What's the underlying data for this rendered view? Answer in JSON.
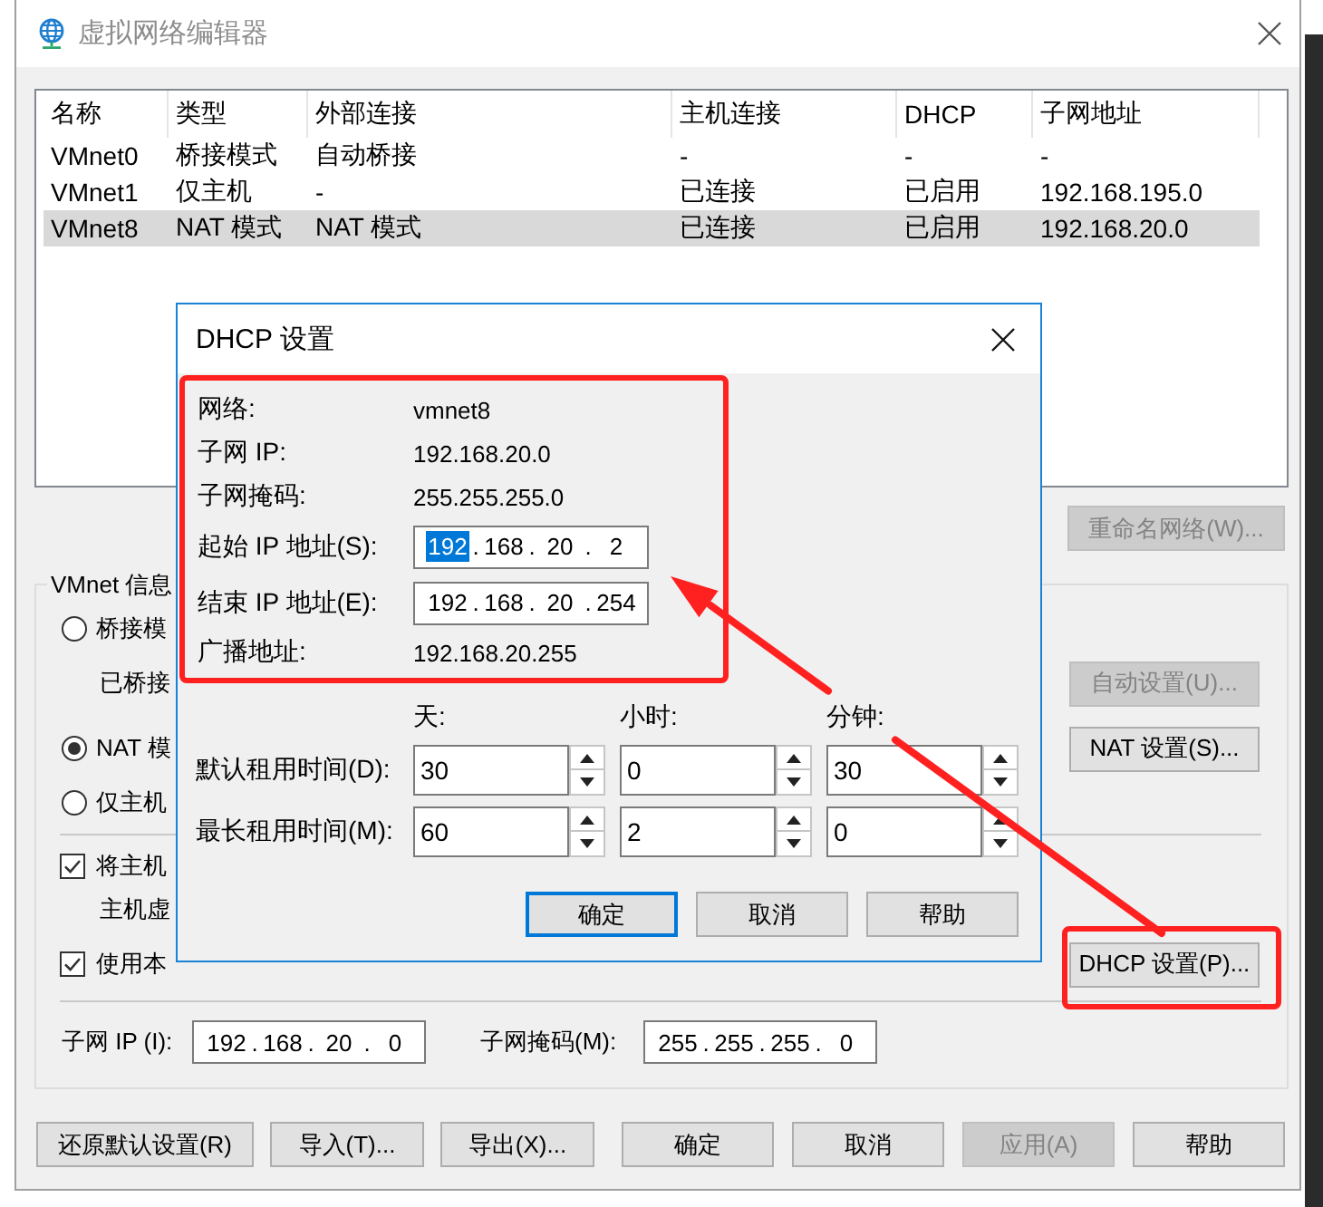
{
  "window": {
    "title": "虚拟网络编辑器"
  },
  "network_table": {
    "columns": [
      "名称",
      "类型",
      "外部连接",
      "主机连接",
      "DHCP",
      "子网地址"
    ],
    "rows": [
      {
        "cells": [
          "VMnet0",
          "桥接模式",
          "自动桥接",
          "-",
          "-",
          "-"
        ],
        "selected": false
      },
      {
        "cells": [
          "VMnet1",
          "仅主机",
          "-",
          "已连接",
          "已启用",
          "192.168.195.0"
        ],
        "selected": false
      },
      {
        "cells": [
          "VMnet8",
          "NAT 模式",
          "NAT 模式",
          "已连接",
          "已启用",
          "192.168.20.0"
        ],
        "selected": true
      }
    ]
  },
  "table_buttons": [
    {
      "label": "重命名网络(W)...",
      "disabled": true
    }
  ],
  "vmnet_info": {
    "title": "VMnet 信息",
    "modes": [
      {
        "label": "桥接模",
        "selected": false,
        "note": "已桥接",
        "button": {
          "label": "自动设置(U)...",
          "disabled": true
        }
      },
      {
        "label": "NAT 模",
        "selected": true,
        "button": {
          "label": "NAT 设置(S)...",
          "disabled": false
        }
      },
      {
        "label": "仅主机",
        "selected": false
      }
    ],
    "options": [
      {
        "label": "将主机",
        "checked": true,
        "note": "主机虚"
      },
      {
        "label": "使用本",
        "checked": true,
        "button": {
          "label": "DHCP 设置(P)...",
          "disabled": false,
          "annotated": true
        }
      }
    ],
    "subnet_ip": {
      "label": "子网 IP (I):",
      "separator": ".",
      "octets": [
        {
          "text": "192",
          "selected": false
        },
        {
          "text": "168",
          "selected": false
        },
        {
          "text": "20",
          "selected": false
        },
        {
          "text": "0",
          "selected": false
        }
      ]
    },
    "subnet_mask": {
      "label": "子网掩码(M):",
      "separator": ".",
      "octets": [
        {
          "text": "255",
          "selected": false
        },
        {
          "text": "255",
          "selected": false
        },
        {
          "text": "255",
          "selected": false
        },
        {
          "text": "0",
          "selected": false
        }
      ]
    }
  },
  "footer_buttons": [
    {
      "label": "还原默认设置(R)",
      "disabled": false
    },
    {
      "label": "导入(T)...",
      "disabled": false
    },
    {
      "label": "导出(X)...",
      "disabled": false
    },
    {
      "label": "确定",
      "disabled": false
    },
    {
      "label": "取消",
      "disabled": false
    },
    {
      "label": "应用(A)",
      "disabled": true
    },
    {
      "label": "帮助",
      "disabled": false
    }
  ],
  "dhcp_dialog": {
    "title": "DHCP 设置",
    "annotated": true,
    "info": [
      {
        "kind": "text",
        "label": "网络:",
        "value": "vmnet8"
      },
      {
        "kind": "text",
        "label": "子网 IP:",
        "value": "192.168.20.0"
      },
      {
        "kind": "text",
        "label": "子网掩码:",
        "value": "255.255.255.0"
      },
      {
        "kind": "ip",
        "label": "起始 IP 地址(S):",
        "separator": ".",
        "octets": [
          {
            "text": "192",
            "selected": true
          },
          {
            "text": "168",
            "selected": false
          },
          {
            "text": "20",
            "selected": false
          },
          {
            "text": "2",
            "selected": false
          }
        ]
      },
      {
        "kind": "ip",
        "label": "结束 IP 地址(E):",
        "separator": ".",
        "octets": [
          {
            "text": "192",
            "selected": false
          },
          {
            "text": "168",
            "selected": false
          },
          {
            "text": "20",
            "selected": false
          },
          {
            "text": "254",
            "selected": false
          }
        ]
      },
      {
        "kind": "text",
        "label": "广播地址:",
        "value": "192.168.20.255"
      }
    ],
    "lease": {
      "columns": [
        "天:",
        "小时:",
        "分钟:"
      ],
      "rows": [
        {
          "label": "默认租用时间(D):",
          "values": [
            "30",
            "0",
            "30"
          ]
        },
        {
          "label": "最长租用时间(M):",
          "values": [
            "60",
            "2",
            "0"
          ]
        }
      ]
    },
    "buttons": [
      {
        "label": "确定",
        "default": true
      },
      {
        "label": "取消",
        "default": false
      },
      {
        "label": "帮助",
        "default": false
      }
    ]
  }
}
